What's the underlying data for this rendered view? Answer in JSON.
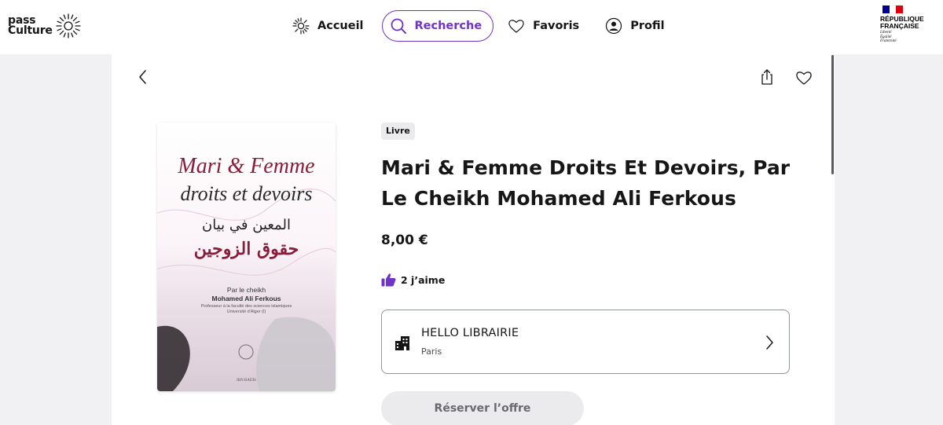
{
  "header": {
    "logo_line1": "pass",
    "logo_line2": "Culture",
    "nav": [
      {
        "label": "Accueil",
        "icon": "sun-icon",
        "active": false
      },
      {
        "label": "Recherche",
        "icon": "search-icon",
        "active": true
      },
      {
        "label": "Favoris",
        "icon": "heart-icon",
        "active": false
      },
      {
        "label": "Profil",
        "icon": "user-icon",
        "active": false
      }
    ],
    "rf": {
      "line1": "RÉPUBLIQUE",
      "line2": "FRANÇAISE",
      "motto1": "Liberté",
      "motto2": "Égalité",
      "motto3": "Fraternité"
    },
    "accent_color": "#6f33c8"
  },
  "offer": {
    "category": "Livre",
    "title": "Mari & Femme Droits Et Devoirs, Par Le Cheikh Mohamed Ali Ferkous",
    "price": "8,00 €",
    "likes": "2 j’aime",
    "venue": {
      "name": "HELLO LIBRAIRIE",
      "city": "Paris"
    },
    "cta": "Réserver l’offre"
  },
  "cover": {
    "title_line1": "Mari & Femme",
    "title_line2": "droits et devoirs",
    "arabic_line1": "المعين في بيان",
    "arabic_line2": "حقوق الزوجين",
    "by": "Par le cheikh",
    "author": "Mohamed Ali Ferkous",
    "affiliation1": "Professeur à la faculté des sciences islamiques",
    "affiliation2": "Université d'Alger (I)",
    "publisher": "IBN BADIS"
  }
}
